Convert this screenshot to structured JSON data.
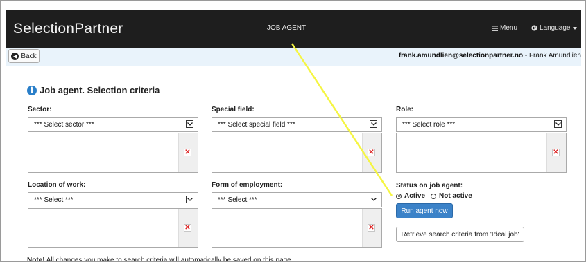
{
  "header": {
    "brand": "SelectionPartner",
    "title": "JOB AGENT",
    "menu_label": "Menu",
    "language_label": "Language"
  },
  "subbar": {
    "back_label": "Back",
    "user_email": "frank.amundlien@selectionpartner.no",
    "user_name_suffix": " - Frank Amundlien"
  },
  "page": {
    "heading": "Job agent. Selection criteria"
  },
  "fields": {
    "sector": {
      "label": "Sector:",
      "select": "*** Select sector ***"
    },
    "special_field": {
      "label": "Special field:",
      "select": "*** Select special field ***"
    },
    "role": {
      "label": "Role:",
      "select": "*** Select role ***"
    },
    "location": {
      "label": "Location of work:",
      "select": "*** Select ***"
    },
    "employment": {
      "label": "Form of employment:",
      "select": "*** Select ***"
    }
  },
  "status": {
    "label": "Status on job agent:",
    "active_label": "Active",
    "inactive_label": "Not active",
    "selected": "Active"
  },
  "buttons": {
    "run_agent": "Run agent now",
    "retrieve": "Retrieve search criteria from 'Ideal job'"
  },
  "note": {
    "strong": "Note!",
    "text": " All changes you make to search criteria will automatically be saved on this page."
  },
  "colors": {
    "topbar": "#1e1e1e",
    "subbar": "#e9f3fb",
    "primary_button": "#3b82c8",
    "annotation_line": "#f5f542"
  }
}
